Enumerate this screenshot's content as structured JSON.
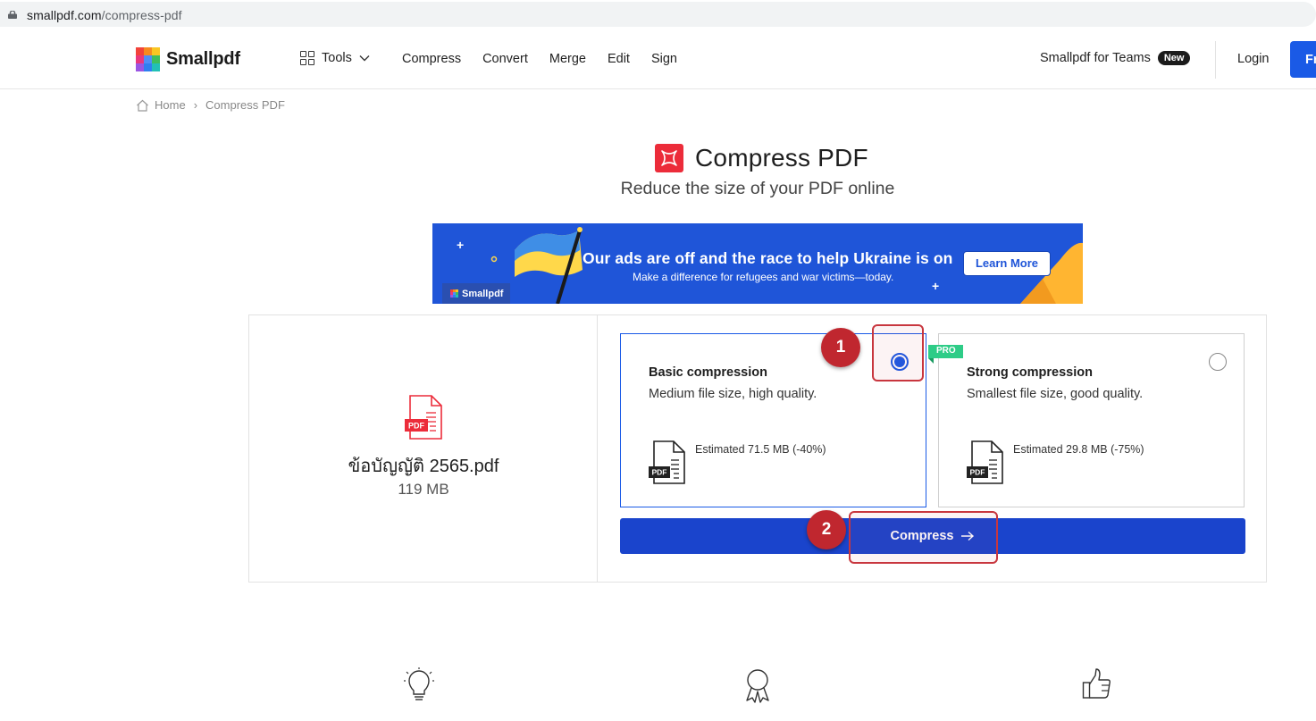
{
  "browser": {
    "url_host": "smallpdf.com",
    "url_path": "/compress-pdf"
  },
  "nav": {
    "logo": "Smallpdf",
    "tools": "Tools",
    "links": [
      "Compress",
      "Convert",
      "Merge",
      "Edit",
      "Sign"
    ],
    "teams": "Smallpdf for Teams",
    "teams_badge": "New",
    "login": "Login",
    "free_button": "Free trial"
  },
  "breadcrumb": {
    "home": "Home",
    "separator": "›",
    "current": "Compress PDF"
  },
  "page": {
    "title": "Compress PDF",
    "subtitle": "Reduce the size of your PDF online"
  },
  "banner": {
    "headline": "Our ads are off and the race to help Ukraine is on",
    "subline": "Make a difference for refugees and war victims—today.",
    "cta": "Learn More",
    "tag": "Smallpdf"
  },
  "file": {
    "icon_label": "PDF",
    "name": "ข้อบัญญัติ 2565.pdf",
    "size": "119 MB"
  },
  "options": {
    "basic": {
      "title": "Basic compression",
      "description": "Medium file size, high quality.",
      "estimate": "Estimated 71.5 MB (-40%)",
      "selected": true
    },
    "strong": {
      "title": "Strong compression",
      "description": "Smallest file size, good quality.",
      "estimate": "Estimated 29.8 MB (-75%)",
      "badge": "PRO",
      "selected": false
    }
  },
  "compress_button": "Compress",
  "annotations": {
    "step1": "1",
    "step2": "2"
  },
  "colors": {
    "brand_blue": "#1a5ae6",
    "button_blue": "#1a44cc",
    "pdf_red": "#ec2c3a",
    "pro_green": "#2ecc87",
    "annotation_red": "#c0272f"
  }
}
